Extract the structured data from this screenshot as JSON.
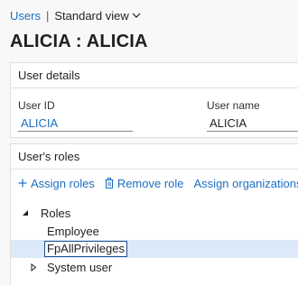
{
  "breadcrumb": {
    "users_link": "Users",
    "separator": "|",
    "view_label": "Standard view"
  },
  "page": {
    "title": "ALICIA : ALICIA"
  },
  "user_details": {
    "header": "User details",
    "user_id_label": "User ID",
    "user_id_value": "ALICIA",
    "user_name_label": "User name",
    "user_name_value": "ALICIA"
  },
  "user_roles": {
    "header": "User's roles",
    "toolbar": {
      "assign_roles": "Assign roles",
      "remove_role": "Remove role",
      "assign_organizations": "Assign organizations"
    },
    "tree": {
      "root": "Roles",
      "items": [
        "Employee",
        "FpAllPrivileges",
        "System user"
      ]
    }
  },
  "colors": {
    "link": "#1d6fc3",
    "selected_row": "#dbe9f8",
    "background": "#f8f8f8"
  },
  "icons": {
    "view_dropdown": "chevron-down-icon",
    "assign_roles": "plus-icon",
    "remove_role": "trash-icon",
    "tree_expanded": "triangle-down-icon",
    "tree_collapsed": "triangle-right-icon"
  }
}
